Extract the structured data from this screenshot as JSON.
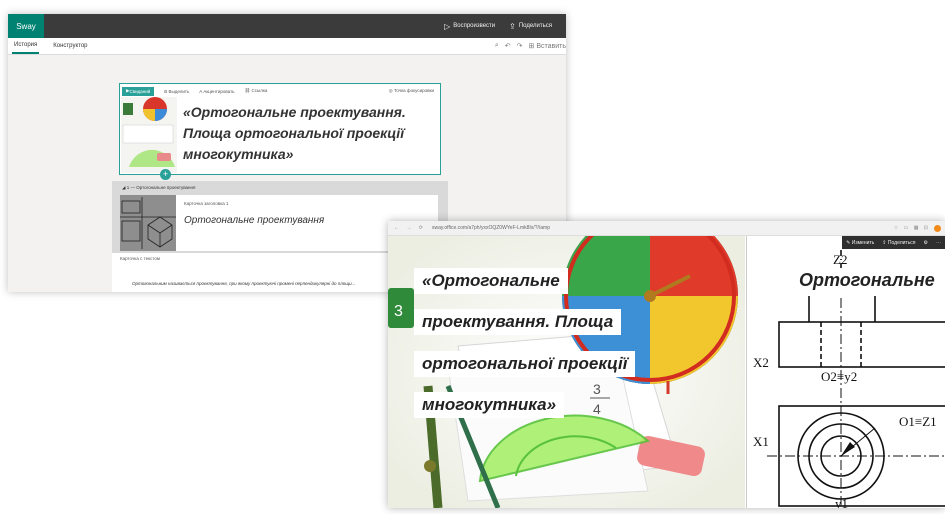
{
  "editor": {
    "app_name": "Sway",
    "actions": {
      "play": "Воспроизвести",
      "share": "Поделиться"
    },
    "tabs": [
      "История",
      "Конструктор"
    ],
    "insert_label": "Вставить",
    "title_card": {
      "background_btn": "Свиданий",
      "toolbar": [
        "Выделить",
        "Акцентировать",
        "Ссылка"
      ],
      "focus": "Точка фокусировки",
      "title": "«Ортогональне проектування. Площа ортогональної проекції многокутника»"
    },
    "section": {
      "heading": "1 — Ортогональне проектування",
      "card_label": "Карточка заголовка 1",
      "card_title": "Ортогональне проектування",
      "text_card_label": "Карточка с текстом",
      "text_body": "Ортогональним називається проектування, при якому проектуючі промені перпендикулярні до площи..."
    }
  },
  "preview": {
    "url": "sway.office.com/a7ph/yxxOQZ0WYeF-Lmk8Ix/?//amp",
    "slide_title_lines": [
      "«Ортогональне",
      "проектування. Площа",
      "ортогональної проекції",
      "многокутника»"
    ],
    "right_toolbar": [
      "Изменить",
      "Поделиться"
    ],
    "right_heading": "Ортогональне",
    "drawing_labels": {
      "z2": "Z2",
      "x2": "X2",
      "o2y2": "O2≡y2",
      "x1": "X1",
      "o1z1": "O1≡Z1",
      "y1": "y1"
    }
  },
  "colors": {
    "accent": "#2aa198",
    "topbar": "#3b3b3b",
    "logo": "#008272"
  }
}
